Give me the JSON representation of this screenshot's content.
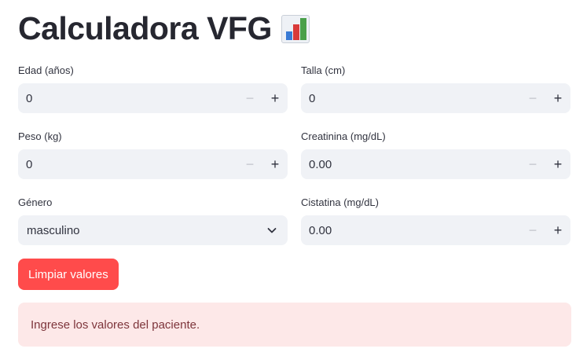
{
  "title": "Calculadora VFG",
  "title_icon": "bar-chart-icon",
  "fields": {
    "edad": {
      "label": "Edad (años)",
      "value": "0"
    },
    "talla": {
      "label": "Talla (cm)",
      "value": "0"
    },
    "peso": {
      "label": "Peso (kg)",
      "value": "0"
    },
    "creatinina": {
      "label": "Creatinina (mg/dL)",
      "value": "0.00"
    },
    "genero": {
      "label": "Género",
      "value": "masculino"
    },
    "cistatina": {
      "label": "Cistatina (mg/dL)",
      "value": "0.00"
    }
  },
  "stepper": {
    "minus": "−",
    "plus": "+"
  },
  "button": {
    "label": "Limpiar valores"
  },
  "alert": {
    "text": "Ingrese los valores del paciente."
  },
  "colors": {
    "primary": "#ff4b4b",
    "input_bg": "#f0f2f6",
    "alert_bg": "#fde8e8",
    "alert_text": "#7d353b"
  }
}
